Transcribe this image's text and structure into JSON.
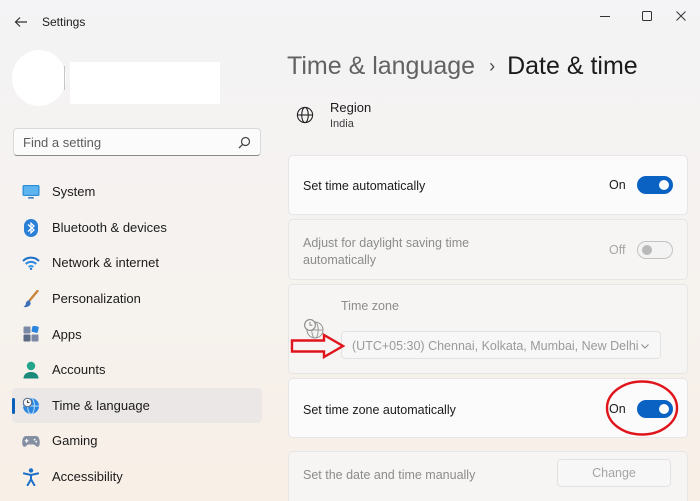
{
  "window": {
    "title": "Settings",
    "controls": {
      "minimize": "minimize-icon",
      "maximize": "maximize-icon",
      "close": "close-icon"
    }
  },
  "search": {
    "placeholder": "Find a setting",
    "icon": "search-icon"
  },
  "sidebar": {
    "items": [
      {
        "label": "System",
        "icon": "monitor-icon",
        "selected": false
      },
      {
        "label": "Bluetooth & devices",
        "icon": "bluetooth-icon",
        "selected": false
      },
      {
        "label": "Network & internet",
        "icon": "wifi-icon",
        "selected": false
      },
      {
        "label": "Personalization",
        "icon": "brush-icon",
        "selected": false
      },
      {
        "label": "Apps",
        "icon": "apps-icon",
        "selected": false
      },
      {
        "label": "Accounts",
        "icon": "person-icon",
        "selected": false
      },
      {
        "label": "Time & language",
        "icon": "globe-clock-icon",
        "selected": true
      },
      {
        "label": "Gaming",
        "icon": "gamepad-icon",
        "selected": false
      },
      {
        "label": "Accessibility",
        "icon": "accessibility-icon",
        "selected": false
      }
    ]
  },
  "breadcrumb": {
    "parent": "Time & language",
    "separator": "›",
    "current": "Date & time"
  },
  "region": {
    "title": "Region",
    "value": "India",
    "icon": "globe-icon"
  },
  "settings": {
    "set_time_auto": {
      "label": "Set time automatically",
      "state": "On"
    },
    "daylight": {
      "label_line1": "Adjust for daylight saving time",
      "label_line2": "automatically",
      "state": "Off"
    },
    "time_zone": {
      "label": "Time zone",
      "selected": "(UTC+05:30) Chennai, Kolkata, Mumbai, New Delhi",
      "icon": "globe-clock-icon"
    },
    "set_tz_auto": {
      "label": "Set time zone automatically",
      "state": "On"
    },
    "manual": {
      "label": "Set the date and time manually",
      "button": "Change"
    }
  },
  "colors": {
    "accent": "#0a62c2",
    "annotation": "#e0151c"
  }
}
